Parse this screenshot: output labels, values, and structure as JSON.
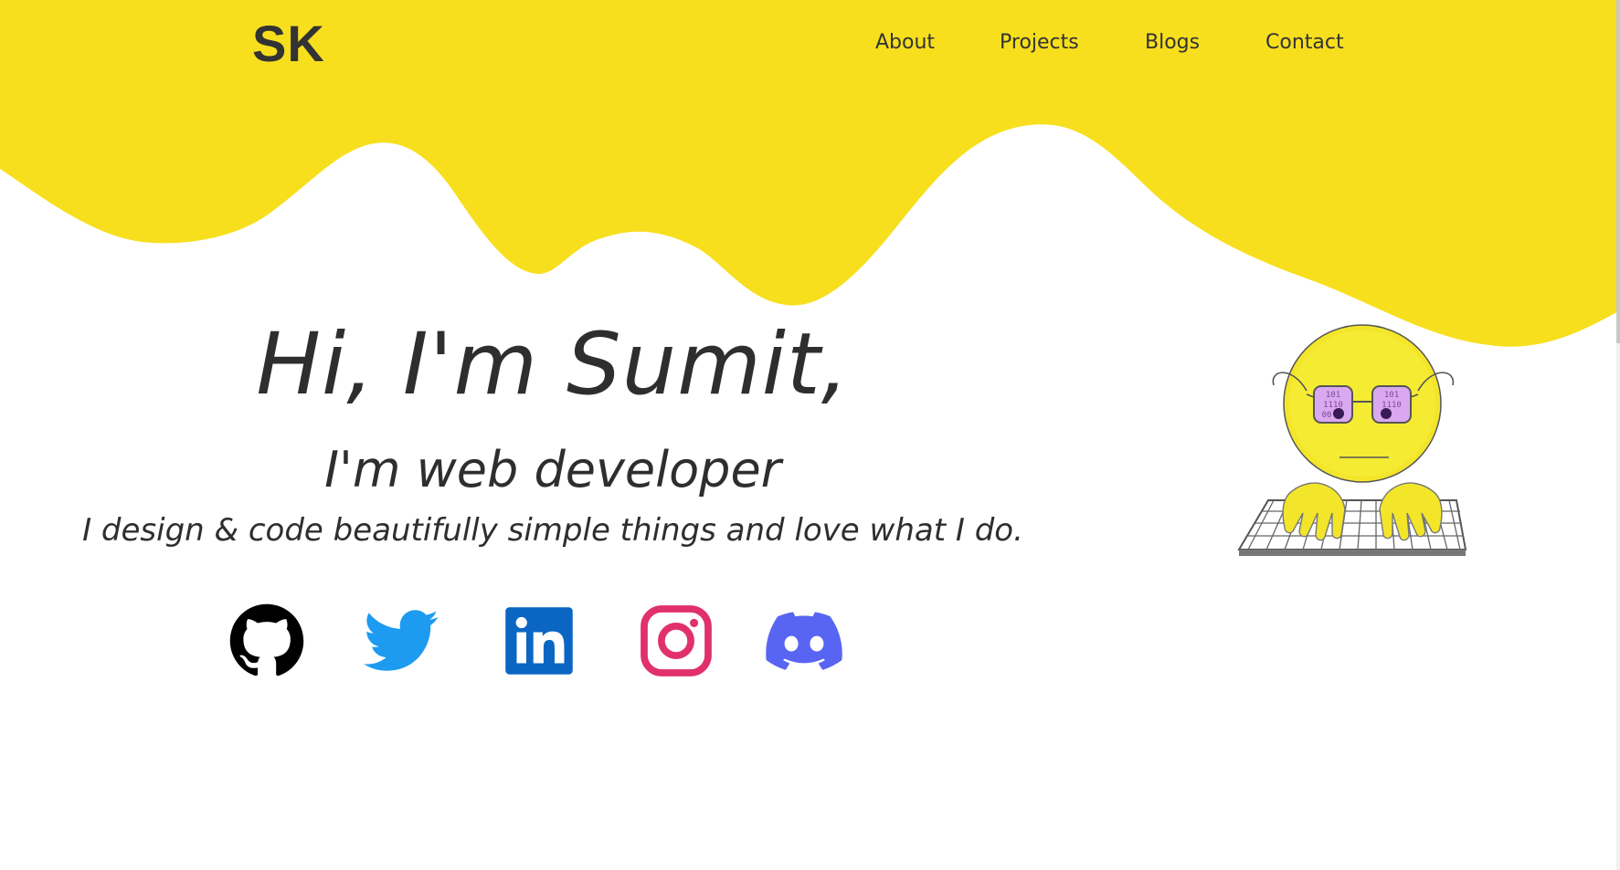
{
  "header": {
    "logo": "SK",
    "nav": [
      {
        "label": "About"
      },
      {
        "label": "Projects"
      },
      {
        "label": "Blogs"
      },
      {
        "label": "Contact"
      }
    ]
  },
  "hero": {
    "greeting": "Hi, I'm Sumit,",
    "role": "I'm web developer",
    "tagline": "I design & code beautifully simple things and love what I do."
  },
  "social": [
    {
      "name": "github",
      "icon": "github-icon",
      "color": "#000000"
    },
    {
      "name": "twitter",
      "icon": "twitter-icon",
      "color": "#1d9bf0"
    },
    {
      "name": "linkedin",
      "icon": "linkedin-icon",
      "color": "#0a66c2"
    },
    {
      "name": "instagram",
      "icon": "instagram-icon",
      "color": "#e1306c"
    },
    {
      "name": "discord",
      "icon": "discord-icon",
      "color": "#5865f2"
    }
  ],
  "illustration": {
    "icon": "coder-emoji-illustration",
    "screen_text": [
      "101",
      "1110",
      "00"
    ]
  },
  "colors": {
    "accent": "#f7df1e",
    "text": "#333333",
    "background": "#ffffff"
  }
}
